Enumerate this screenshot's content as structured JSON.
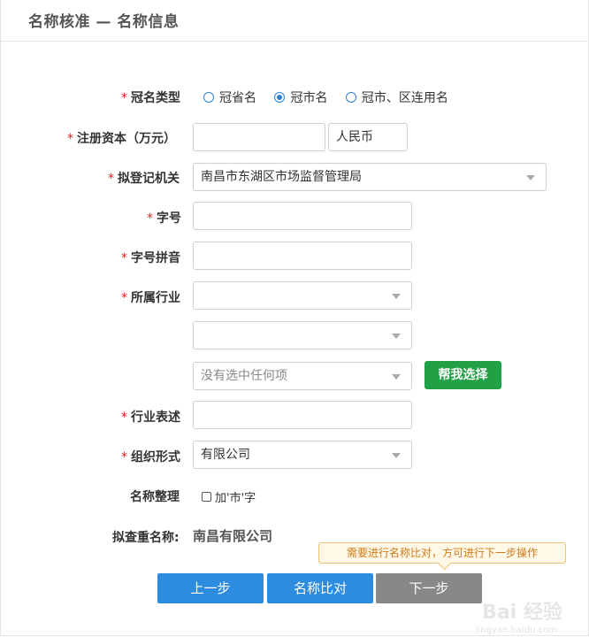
{
  "header": {
    "title": "名称核准 — 名称信息"
  },
  "form": {
    "crown_type": {
      "label": "冠名类型",
      "options": [
        "冠省名",
        "冠市名",
        "冠市、区连用名"
      ],
      "selected": "冠市名"
    },
    "capital": {
      "label": "注册资本（万元）",
      "value": "",
      "currency": "人民币"
    },
    "authority": {
      "label": "拟登记机关",
      "value": "南昌市东湖区市场监督管理局"
    },
    "trade_name": {
      "label": "字号",
      "value": ""
    },
    "trade_pinyin": {
      "label": "字号拼音",
      "value": ""
    },
    "industry": {
      "label": "所属行业",
      "select1": "",
      "select2": "",
      "select3_placeholder": "没有选中任何项",
      "help_button": "帮我选择"
    },
    "industry_desc": {
      "label": "行业表述",
      "value": ""
    },
    "org_form": {
      "label": "组织形式",
      "value": "有限公司"
    },
    "name_arrange": {
      "label": "名称整理",
      "checkbox_label": "加'市'字",
      "checked": false
    },
    "duplicate": {
      "label": "拟查重名称:",
      "value": "南昌有限公司"
    }
  },
  "tooltip": "需要进行名称比对，方可进行下一步操作",
  "actions": {
    "prev": "上一步",
    "compare": "名称比对",
    "next": "下一步"
  },
  "watermark": {
    "main": "Bai 经验",
    "sub": "jingyan.baidu.com"
  },
  "colors": {
    "accent": "#2d8ce0",
    "green": "#22a046",
    "disabled": "#888888",
    "required": "#e02020"
  }
}
